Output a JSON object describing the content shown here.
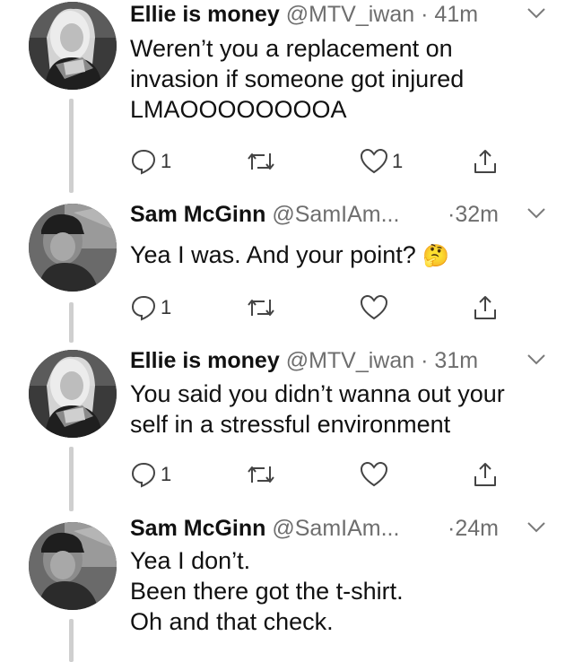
{
  "tweets": [
    {
      "display_name": "Ellie is money",
      "handle": "@MTV_iwan",
      "time": "· 41m",
      "lines": [
        "Weren’t you a replacement on",
        "invasion if someone got injured",
        "LMAOOOOOOOOA"
      ],
      "reply_count": "1",
      "like_count": "1",
      "avatar": "ellie-avatar"
    },
    {
      "display_name": "Sam McGinn",
      "handle": "@SamIAm...",
      "time": "·32m",
      "lines": [
        "Yea I was. And your point?"
      ],
      "emoji": "🤔",
      "reply_count": "1",
      "like_count": "",
      "avatar": "sam-avatar"
    },
    {
      "display_name": "Ellie is money",
      "handle": "@MTV_iwan",
      "time": "· 31m",
      "lines": [
        "You said you didn’t wanna out your",
        "self in a stressful environment"
      ],
      "reply_count": "1",
      "like_count": "",
      "avatar": "ellie-avatar"
    },
    {
      "display_name": "Sam McGinn",
      "handle": "@SamIAm...",
      "time": "·24m",
      "lines": [
        "Yea I don’t.",
        "Been there got the t-shirt.",
        "Oh and that check."
      ],
      "avatar": "sam-avatar"
    }
  ],
  "colors": {
    "text": "#111111",
    "muted": "#6e6e6e",
    "line": "#cfcfcf"
  },
  "icons": [
    "reply-icon",
    "retweet-icon",
    "like-icon",
    "share-icon",
    "chevron-down-icon"
  ]
}
